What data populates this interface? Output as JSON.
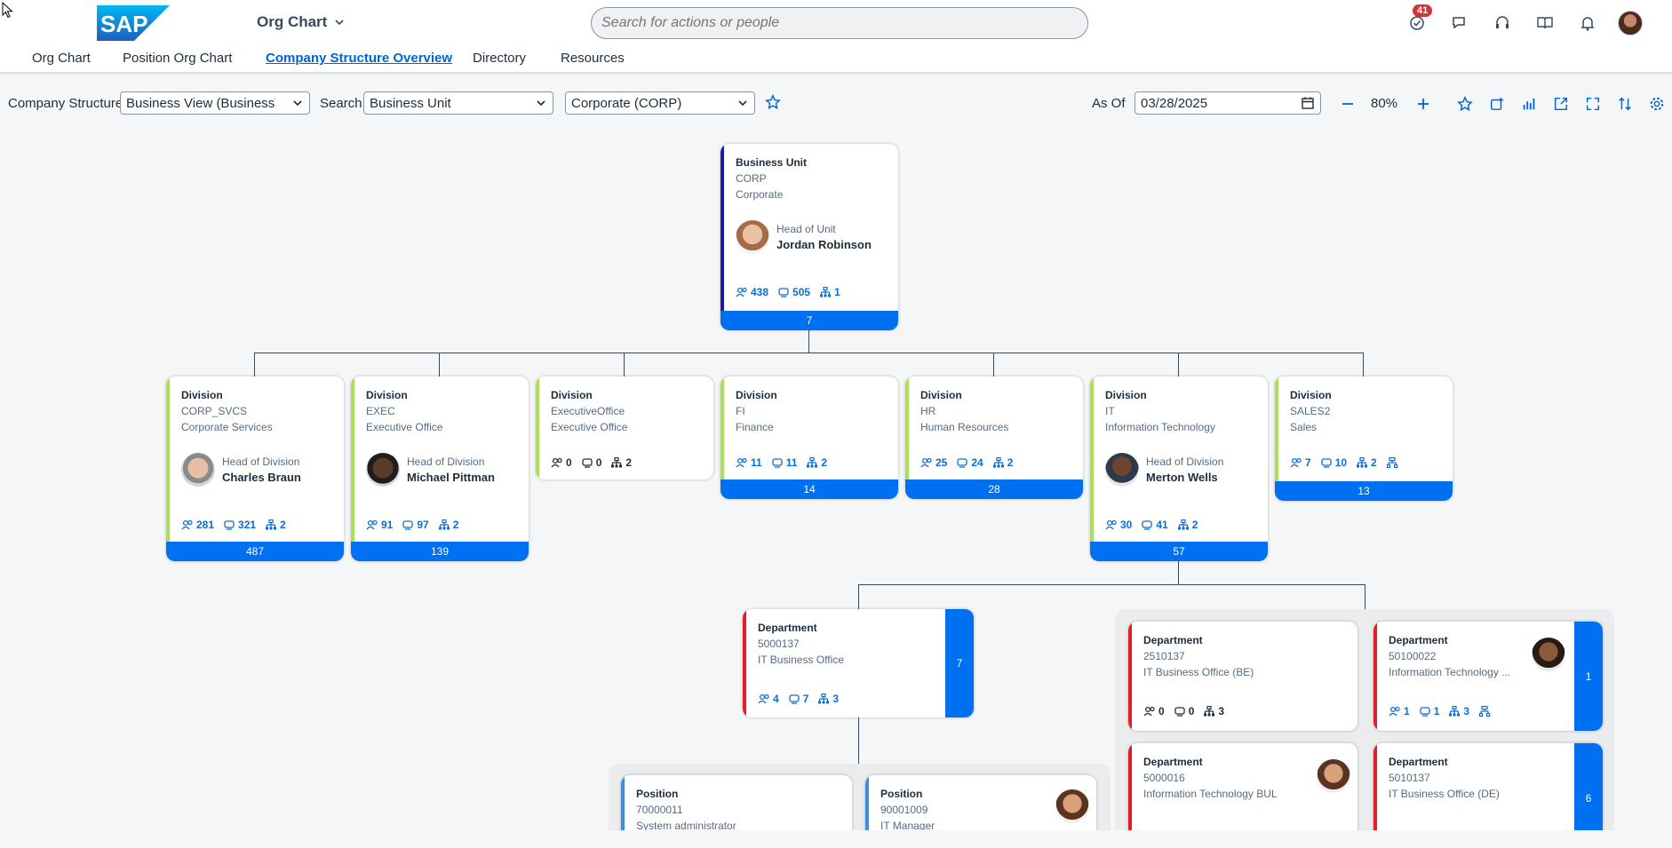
{
  "shell": {
    "logo_text": "SAP",
    "app_title": "Org Chart",
    "search_placeholder": "Search for actions or people",
    "notification_badge": "41"
  },
  "nav": {
    "tabs": [
      {
        "label": "Org Chart",
        "active": false
      },
      {
        "label": "Position Org Chart",
        "active": false
      },
      {
        "label": "Company Structure Overview",
        "active": true
      },
      {
        "label": "Directory",
        "active": false
      },
      {
        "label": "Resources",
        "active": false
      }
    ]
  },
  "toolbar": {
    "structure_label": "Company Structure",
    "structure_value": "Business View (BusinessView)",
    "search_label": "Search",
    "search_type": "Business Unit",
    "search_value": "Corporate (CORP)",
    "as_of_label": "As Of",
    "date": "03/28/2025",
    "zoom": "80%"
  },
  "root": {
    "type": "Business Unit",
    "code": "CORP",
    "name": "Corporate",
    "head_role": "Head of Unit",
    "head_name": "Jordan Robinson",
    "s1": "438",
    "s2": "505",
    "s3": "1",
    "count": "7"
  },
  "divisions": [
    {
      "type": "Division",
      "code": "CORP_SVCS",
      "name": "Corporate Services",
      "head_role": "Head of Division",
      "head_name": "Charles Braun",
      "s1": "281",
      "s2": "321",
      "s3": "2",
      "count": "487"
    },
    {
      "type": "Division",
      "code": "EXEC",
      "name": "Executive Office",
      "head_role": "Head of Division",
      "head_name": "Michael Pittman",
      "s1": "91",
      "s2": "97",
      "s3": "2",
      "count": "139"
    },
    {
      "type": "Division",
      "code": "ExecutiveOffice",
      "name": "Executive Office",
      "s1": "0",
      "s2": "0",
      "s3": "2"
    },
    {
      "type": "Division",
      "code": "FI",
      "name": "Finance",
      "s1": "11",
      "s2": "11",
      "s3": "2",
      "count": "14"
    },
    {
      "type": "Division",
      "code": "HR",
      "name": "Human Resources",
      "s1": "25",
      "s2": "24",
      "s3": "2",
      "count": "28"
    },
    {
      "type": "Division",
      "code": "IT",
      "name": "Information Technology",
      "head_role": "Head of Division",
      "head_name": "Merton Wells",
      "s1": "30",
      "s2": "41",
      "s3": "2",
      "count": "57"
    },
    {
      "type": "Division",
      "code": "SALES2",
      "name": "Sales",
      "s1": "7",
      "s2": "10",
      "s3": "2",
      "count": "13"
    }
  ],
  "departments": [
    {
      "type": "Department",
      "code": "5000137",
      "name": "IT Business Office",
      "s1": "4",
      "s2": "7",
      "s3": "3",
      "count": "7"
    },
    {
      "type": "Department",
      "code": "2510137",
      "name": "IT Business Office (BE)",
      "s1": "0",
      "s2": "0",
      "s3": "3"
    },
    {
      "type": "Department",
      "code": "50100022",
      "name": "Information Technology ...",
      "s1": "1",
      "s2": "1",
      "s3": "3",
      "count": "1"
    },
    {
      "type": "Department",
      "code": "5000016",
      "name": "Information Technology BUL"
    },
    {
      "type": "Department",
      "code": "5010137",
      "name": "IT Business Office (DE)",
      "count": "6"
    }
  ],
  "positions": [
    {
      "type": "Position",
      "code": "70000011",
      "name": "System administrator"
    },
    {
      "type": "Position",
      "code": "90001009",
      "name": "IT Manager"
    }
  ],
  "colors": {
    "accent": "#0070f2",
    "bu_stripe": "#1a1aa6",
    "division_stripe": "#a8e05a",
    "department_stripe": "#e01e25",
    "position_stripe": "#3b8fe0"
  }
}
